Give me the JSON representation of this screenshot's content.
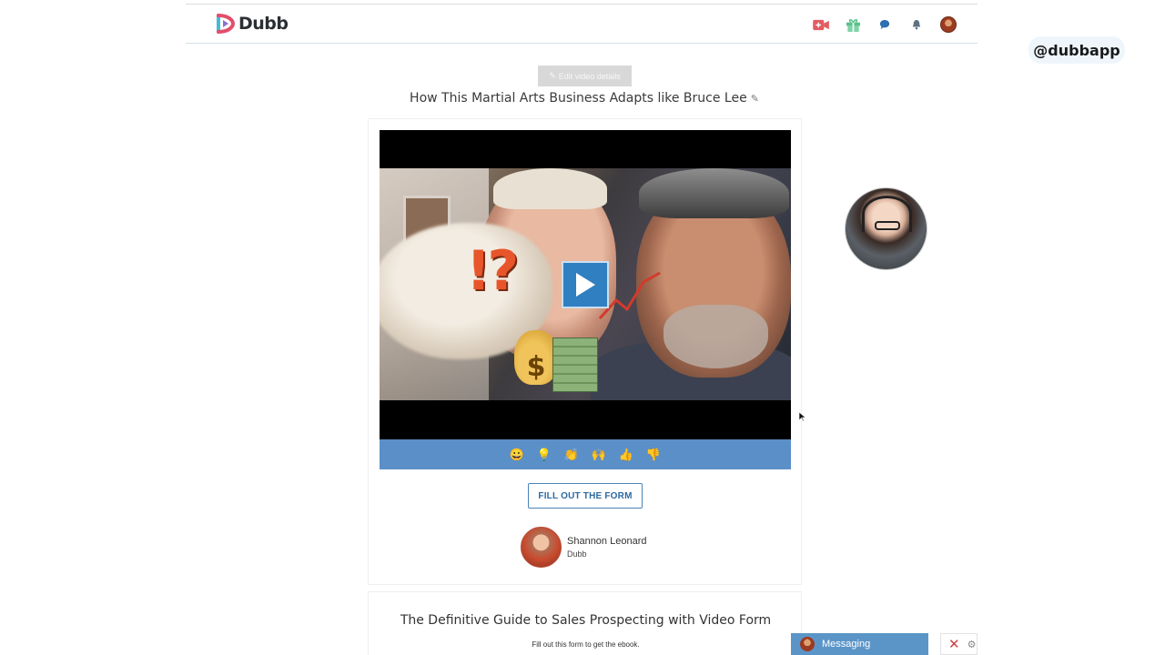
{
  "header": {
    "brand": "Dubb",
    "icons": [
      "video-camera-plus-icon",
      "gift-icon",
      "chat-icon",
      "bell-icon",
      "avatar"
    ]
  },
  "watermark": {
    "handle": "@dubbapp"
  },
  "editor": {
    "edit_label": "Edit video details"
  },
  "video": {
    "title": "How This Martial Arts Business Adapts like Bruce Lee",
    "overlay_text": "!?",
    "reactions": [
      "😀",
      "💡",
      "👏",
      "🙌",
      "👍",
      "👎"
    ]
  },
  "cta": {
    "label": "FILL OUT THE FORM"
  },
  "author": {
    "name": "Shannon Leonard",
    "company": "Dubb"
  },
  "form": {
    "title": "The Definitive Guide to Sales Prospecting with Video Form",
    "subtitle": "Fill out this form to get the ebook."
  },
  "messaging": {
    "label": "Messaging"
  },
  "colors": {
    "brand_blue": "#2f7fc1",
    "reaction_bar": "#5b8fc8",
    "messaging_bar": "#5b95c8",
    "cta_border": "#4b84b8"
  }
}
